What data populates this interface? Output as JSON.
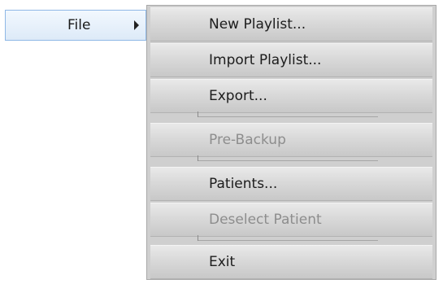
{
  "menu": {
    "parent_label": "File",
    "items": [
      {
        "label": "New Playlist...",
        "enabled": true
      },
      {
        "label": "Import Playlist...",
        "enabled": true
      },
      {
        "label": "Export...",
        "enabled": true
      },
      {
        "label": "Pre-Backup",
        "enabled": false
      },
      {
        "label": "Patients...",
        "enabled": true
      },
      {
        "label": "Deselect Patient",
        "enabled": false
      },
      {
        "label": "Exit",
        "enabled": true
      }
    ]
  },
  "colors": {
    "hover_border": "#8fb8e6",
    "menu_background": "#d4d4d4",
    "disabled_text": "#8d8d8d"
  }
}
